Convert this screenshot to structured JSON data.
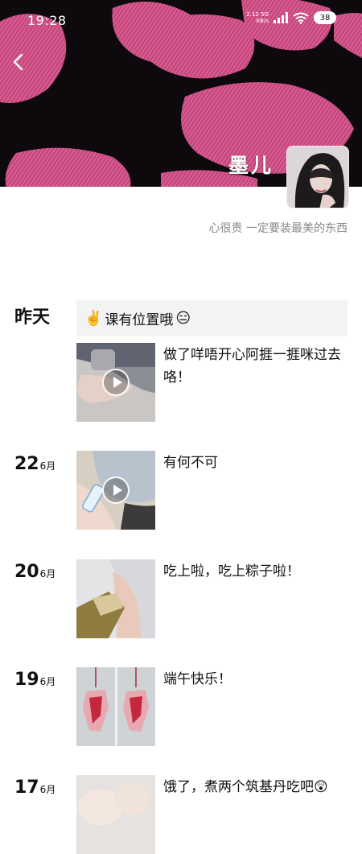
{
  "status_bar": {
    "time": "19:28",
    "net_speed_value": "2.12",
    "net_speed_unit": "KB/s",
    "network_type": "5G",
    "battery": "38"
  },
  "profile": {
    "nickname": "墨儿",
    "signature": "心很贵 一定要装最美的东西"
  },
  "moments": [
    {
      "day_label": "昨天",
      "text_post": "课有位置哦",
      "text_post_emoji_before": "✌️",
      "text_post_emoji_after": "😑",
      "media_type": "video",
      "caption": "做了咩唔开心阿捱一捱咪过去咯！"
    },
    {
      "day": "22",
      "month": "6月",
      "media_type": "video",
      "caption": "有何不可"
    },
    {
      "day": "20",
      "month": "6月",
      "media_type": "image",
      "caption": "吃上啦，吃上粽子啦！"
    },
    {
      "day": "19",
      "month": "6月",
      "media_type": "image",
      "caption": "端午快乐！"
    },
    {
      "day": "17",
      "month": "6月",
      "media_type": "image",
      "caption": "饿了，煮两个筑基丹吃吧",
      "caption_emoji": "😲"
    }
  ],
  "colors": {
    "cover_bg": "#0d090c",
    "cover_lips": "#d9578f",
    "text_post_bg": "#f3f3f3",
    "signature": "#888888"
  },
  "icons": [
    "back-arrow-icon",
    "signal-icon",
    "wifi-icon",
    "battery-icon",
    "play-icon"
  ]
}
